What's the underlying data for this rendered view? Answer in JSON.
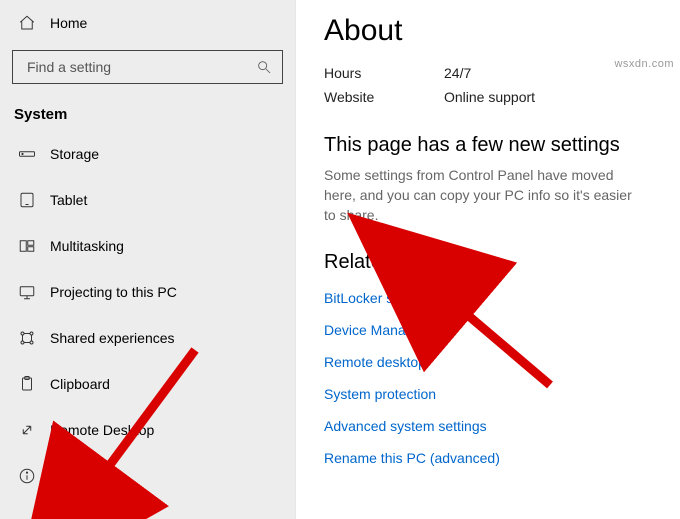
{
  "sidebar": {
    "home": "Home",
    "search_placeholder": "Find a setting",
    "category": "System",
    "items": [
      {
        "id": "storage",
        "label": "Storage"
      },
      {
        "id": "tablet",
        "label": "Tablet"
      },
      {
        "id": "multitasking",
        "label": "Multitasking"
      },
      {
        "id": "projecting",
        "label": "Projecting to this PC"
      },
      {
        "id": "shared-experiences",
        "label": "Shared experiences"
      },
      {
        "id": "clipboard",
        "label": "Clipboard"
      },
      {
        "id": "remote-desktop",
        "label": "Remote Desktop"
      },
      {
        "id": "about",
        "label": "About"
      }
    ]
  },
  "main": {
    "title": "About",
    "info": {
      "hours_label": "Hours",
      "hours_value": "24/7",
      "website_label": "Website",
      "website_value": "Online support"
    },
    "new_settings": {
      "heading": "This page has a few new settings",
      "desc": "Some settings from Control Panel have moved here, and you can copy your PC info so it's easier to share."
    },
    "related": {
      "heading": "Related settings",
      "links": [
        "BitLocker settings",
        "Device Manager",
        "Remote desktop",
        "System protection",
        "Advanced system settings",
        "Rename this PC (advanced)"
      ]
    }
  },
  "watermark": "wsxdn.com",
  "colors": {
    "link": "#0066cc",
    "accent_arrow": "#d90000"
  }
}
